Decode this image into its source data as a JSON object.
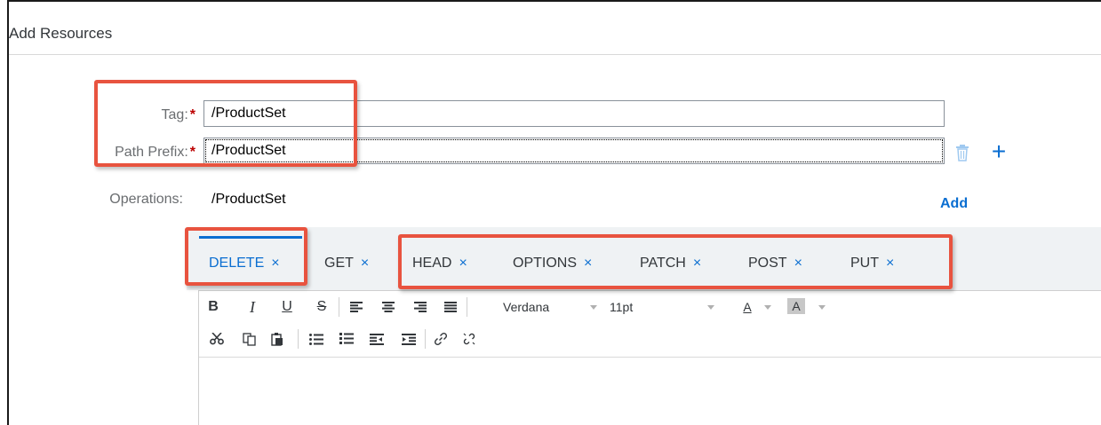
{
  "dialog": {
    "title": "Add Resources"
  },
  "form": {
    "tag_label": "Tag:",
    "tag_value": "/ProductSet",
    "path_prefix_label": "Path Prefix:",
    "path_prefix_value": "/ProductSet",
    "required_mark": "*",
    "operations_label": "Operations:",
    "operations_value": "/ProductSet",
    "add_link": "Add",
    "add_icon": "+"
  },
  "tabs": [
    {
      "label": "DELETE",
      "close": "×",
      "active": true
    },
    {
      "label": "GET",
      "close": "×"
    },
    {
      "label": "HEAD",
      "close": "×"
    },
    {
      "label": "OPTIONS",
      "close": "×"
    },
    {
      "label": "PATCH",
      "close": "×"
    },
    {
      "label": "POST",
      "close": "×"
    },
    {
      "label": "PUT",
      "close": "×"
    }
  ],
  "toolbar": {
    "bold": "B",
    "italic": "I",
    "underline": "U",
    "strike": "S",
    "font_family": "Verdana",
    "font_size": "11pt",
    "text_color": "A",
    "bg_color": "A"
  },
  "colors": {
    "accent": "#0a6ed1",
    "highlight": "#e8533f",
    "required": "#bb0000",
    "tabbar": "#eff2f4"
  }
}
